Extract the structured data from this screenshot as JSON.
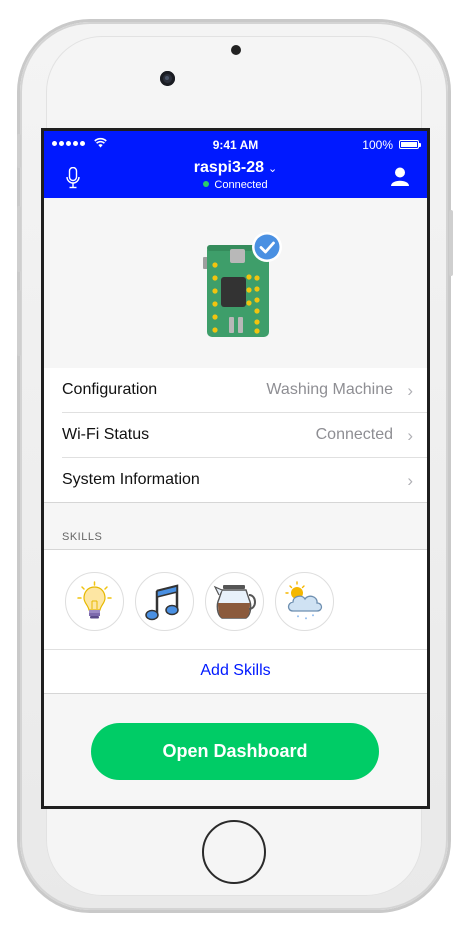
{
  "status_bar": {
    "time": "9:41 AM",
    "battery_percent": "100%"
  },
  "header": {
    "device_name": "raspi3-28",
    "dropdown_glyph": "⌄",
    "connection_status": "Connected",
    "accent_color": "#0019ff",
    "status_dot_color": "#2ccc6b",
    "left_icon": "microphone-icon",
    "right_icon": "user-icon"
  },
  "hero": {
    "image": "raspberry-pi-board-with-check-badge"
  },
  "settings": [
    {
      "label": "Configuration",
      "value": "Washing Machine",
      "chevron": "›"
    },
    {
      "label": "Wi-Fi Status",
      "value": "Connected",
      "chevron": "›"
    },
    {
      "label": "System Information",
      "value": "",
      "chevron": "›"
    }
  ],
  "skills": {
    "section_title": "SKILLS",
    "items": [
      {
        "icon": "lightbulb-icon"
      },
      {
        "icon": "music-note-icon"
      },
      {
        "icon": "coffee-pot-icon"
      },
      {
        "icon": "weather-cloud-icon"
      }
    ],
    "add_label": "Add Skills"
  },
  "cta": {
    "label": "Open Dashboard",
    "color": "#00cc66"
  }
}
